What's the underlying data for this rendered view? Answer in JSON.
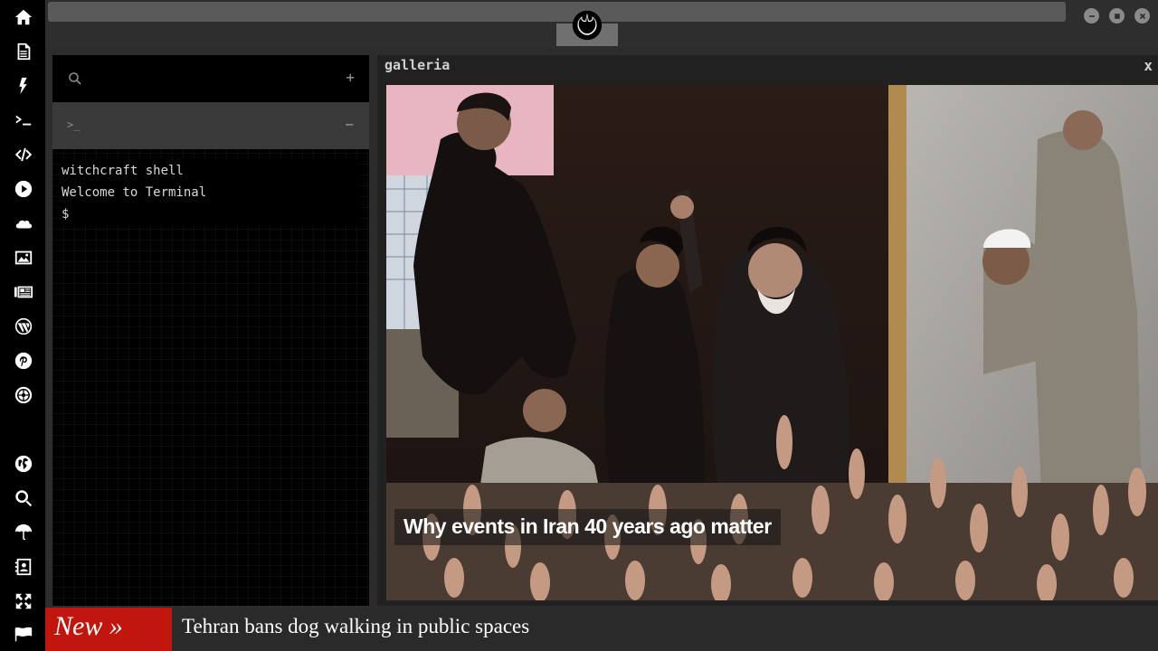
{
  "sidebar": {
    "icons": [
      "home-icon",
      "document-icon",
      "bolt-icon",
      "terminal-icon",
      "code-icon",
      "play-icon",
      "cloud-icon",
      "image-icon",
      "newspaper-icon",
      "wordpress-icon",
      "pinterest-icon",
      "empire-icon",
      "grid-sphere-icon",
      "globe-icon",
      "search-icon",
      "umbrella-icon",
      "contact-card-icon",
      "expand-icon",
      "flag-icon"
    ]
  },
  "topbar": {
    "logo": "rebel-alliance-icon",
    "window_buttons": [
      "minimize-icon",
      "maximize-icon",
      "close-icon"
    ]
  },
  "terminal": {
    "add_label": "+",
    "prompt_glyph": ">_",
    "minus_label": "−",
    "lines": [
      "witchcraft shell",
      "Welcome to Terminal",
      "$"
    ]
  },
  "gallery": {
    "title": "galleria",
    "close_label": "x",
    "caption": "Why events in Iran 40 years ago matter"
  },
  "ticker": {
    "label": "New »",
    "headline": "Tehran bans dog walking in public spaces"
  },
  "colors": {
    "sidebar_bg": "#000000",
    "panel_bg": "#2c2c2c",
    "ticker_accent": "#c0160e"
  }
}
